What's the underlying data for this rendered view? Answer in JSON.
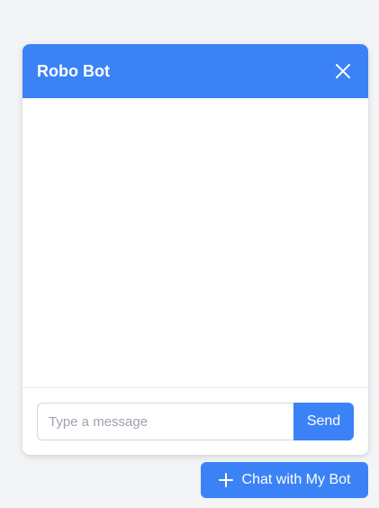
{
  "chat": {
    "title": "Robo Bot",
    "close_icon": "close-icon",
    "input": {
      "value": "",
      "placeholder": "Type a message"
    },
    "send_label": "Send"
  },
  "launcher": {
    "label": "Chat with My Bot",
    "icon": "plus-icon"
  },
  "colors": {
    "accent": "#3b82f6",
    "background": "#f3f4f6",
    "panel": "#ffffff"
  }
}
